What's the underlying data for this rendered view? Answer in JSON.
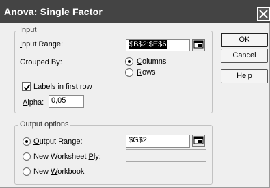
{
  "window": {
    "title": "Anova: Single Factor"
  },
  "input_group": {
    "legend": "Input",
    "input_range_label": "Input Range:",
    "input_range_value": "$B$2:$E$6",
    "grouped_by_label": "Grouped By:",
    "columns_label": "Columns",
    "rows_label": "Rows",
    "grouped_by_selected": "Columns",
    "labels_checkbox_label": "Labels in first row",
    "labels_checked": true,
    "alpha_label": "Alpha:",
    "alpha_value": "0,05"
  },
  "output_group": {
    "legend": "Output options",
    "output_range_label": "Output Range:",
    "output_range_value": "$G$2",
    "new_ply_label": "New Worksheet Ply:",
    "new_ply_value": "",
    "new_workbook_label": "New Workbook",
    "selected": "Output Range"
  },
  "buttons": {
    "ok": "OK",
    "cancel": "Cancel",
    "help": "Help"
  },
  "icons": {
    "close": "close-icon",
    "range_selector": "range-collapse-icon",
    "check": "checkmark-icon"
  }
}
